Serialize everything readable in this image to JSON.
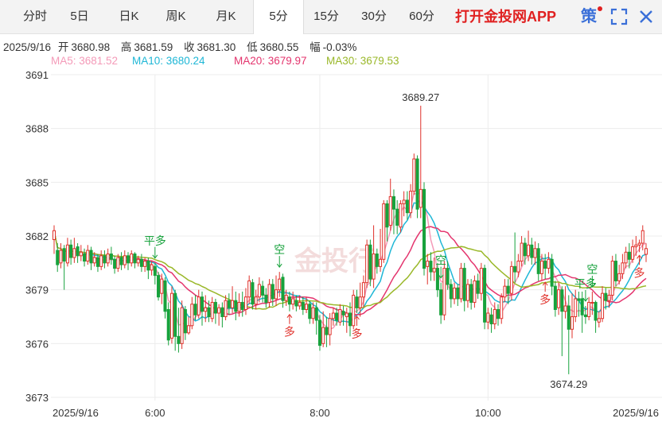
{
  "tabs": [
    {
      "label": "分时",
      "active": false
    },
    {
      "label": "5日",
      "active": false
    },
    {
      "label": "日K",
      "active": false
    },
    {
      "label": "周K",
      "active": false
    },
    {
      "label": "月K",
      "active": false
    },
    {
      "label": "5分",
      "active": true
    },
    {
      "label": "15分",
      "active": false
    },
    {
      "label": "30分",
      "active": false
    },
    {
      "label": "60分",
      "active": false
    }
  ],
  "brand": "打开金投网APP",
  "strategy_icon": "策",
  "colors": {
    "up": "#e0302a",
    "down": "#17a23c",
    "ma5": "#f49ab8",
    "ma10": "#1fb7d6",
    "ma20": "#e4356e",
    "ma30": "#9ab829"
  },
  "ohlc": {
    "date": "2025/9/16",
    "open_label": "开",
    "open": "3680.98",
    "high_label": "高",
    "high": "3681.59",
    "close_label": "收",
    "close": "3681.30",
    "low_label": "低",
    "low": "3680.55",
    "change_label": "幅",
    "change": "-0.03%"
  },
  "ma": {
    "ma5": "MA5: 3681.52",
    "ma10": "MA10: 3680.24",
    "ma20": "MA20: 3679.97",
    "ma30": "MA30: 3679.53"
  },
  "chart_data": {
    "type": "candlestick",
    "y_ticks": [
      "3691",
      "3688",
      "3685",
      "3682",
      "3679",
      "3676",
      "3673"
    ],
    "ylim": [
      3673,
      3691
    ],
    "x_ticks": [
      "2025/9/16",
      "6:00",
      "8:00",
      "10:00",
      "2025/9/16"
    ],
    "max_label": "3689.27",
    "min_label": "3674.29",
    "annotations": [
      {
        "text": "平多",
        "index": 30
      },
      {
        "text": "空",
        "index": 67
      },
      {
        "text": "多",
        "index": 70
      },
      {
        "text": "多",
        "index": 90
      },
      {
        "text": "空",
        "index": 115
      },
      {
        "text": "多",
        "index": 146
      },
      {
        "text": "平多",
        "index": 158
      },
      {
        "text": "空",
        "index": 160
      },
      {
        "text": "多",
        "index": 174
      }
    ],
    "candles": [
      [
        3681.8,
        3682.3,
        3681.0,
        3682.6
      ],
      [
        3681.2,
        3680.4,
        3680.0,
        3681.6
      ],
      [
        3680.5,
        3681.2,
        3680.2,
        3681.6
      ],
      [
        3681.3,
        3680.6,
        3679.0,
        3681.5
      ],
      [
        3680.5,
        3681.5,
        3680.3,
        3681.9
      ],
      [
        3681.5,
        3680.8,
        3680.4,
        3681.8
      ],
      [
        3680.8,
        3681.3,
        3680.5,
        3681.9
      ],
      [
        3681.4,
        3680.9,
        3680.5,
        3681.6
      ],
      [
        3680.9,
        3681.1,
        3680.6,
        3681.5
      ],
      [
        3681.0,
        3680.6,
        3680.3,
        3681.3
      ],
      [
        3680.6,
        3681.2,
        3680.4,
        3681.5
      ],
      [
        3681.2,
        3680.5,
        3680.1,
        3681.4
      ],
      [
        3680.5,
        3680.8,
        3680.3,
        3681.1
      ],
      [
        3680.8,
        3680.3,
        3680.0,
        3681.0
      ],
      [
        3680.3,
        3680.9,
        3680.1,
        3681.2
      ],
      [
        3680.9,
        3680.5,
        3680.2,
        3681.2
      ],
      [
        3680.5,
        3681.0,
        3680.3,
        3681.3
      ],
      [
        3681.0,
        3680.7,
        3680.4,
        3681.4
      ],
      [
        3680.7,
        3680.2,
        3679.9,
        3680.9
      ],
      [
        3680.2,
        3680.8,
        3680.0,
        3681.0
      ],
      [
        3680.8,
        3680.4,
        3680.1,
        3681.1
      ],
      [
        3680.4,
        3680.9,
        3680.2,
        3681.2
      ],
      [
        3680.9,
        3680.5,
        3680.1,
        3681.1
      ],
      [
        3680.5,
        3681.0,
        3680.3,
        3681.2
      ],
      [
        3681.0,
        3680.5,
        3680.2,
        3681.1
      ],
      [
        3680.5,
        3680.7,
        3680.3,
        3680.9
      ],
      [
        3680.7,
        3680.3,
        3680.0,
        3681.0
      ],
      [
        3680.3,
        3680.6,
        3680.0,
        3680.8
      ],
      [
        3680.6,
        3680.1,
        3679.6,
        3680.8
      ],
      [
        3680.1,
        3680.4,
        3679.8,
        3680.6
      ],
      [
        3680.3,
        3679.8,
        3679.3,
        3680.5
      ],
      [
        3679.8,
        3678.6,
        3678.4,
        3680.0
      ],
      [
        3678.8,
        3679.6,
        3678.2,
        3679.9
      ],
      [
        3679.5,
        3677.8,
        3677.4,
        3679.7
      ],
      [
        3677.9,
        3676.2,
        3675.9,
        3678.3
      ],
      [
        3676.3,
        3678.8,
        3676.0,
        3679.2
      ],
      [
        3678.8,
        3676.4,
        3675.6,
        3679.0
      ],
      [
        3676.4,
        3676.0,
        3675.5,
        3678.0
      ],
      [
        3676.0,
        3678.0,
        3675.7,
        3678.4
      ],
      [
        3677.9,
        3676.6,
        3676.2,
        3678.1
      ],
      [
        3676.6,
        3677.0,
        3676.5,
        3677.5
      ],
      [
        3677.0,
        3678.2,
        3676.8,
        3678.6
      ],
      [
        3678.2,
        3677.6,
        3677.3,
        3678.7
      ],
      [
        3677.6,
        3678.6,
        3677.4,
        3679.0
      ],
      [
        3678.6,
        3677.8,
        3677.0,
        3678.9
      ],
      [
        3677.8,
        3678.0,
        3677.2,
        3678.7
      ],
      [
        3678.0,
        3677.5,
        3677.2,
        3678.4
      ],
      [
        3677.4,
        3678.3,
        3677.2,
        3678.6
      ],
      [
        3678.3,
        3677.7,
        3677.1,
        3678.5
      ],
      [
        3677.7,
        3678.0,
        3677.0,
        3678.2
      ],
      [
        3678.0,
        3677.5,
        3676.9,
        3678.3
      ],
      [
        3677.5,
        3678.4,
        3677.3,
        3678.7
      ],
      [
        3678.4,
        3678.0,
        3677.6,
        3678.8
      ],
      [
        3678.0,
        3678.4,
        3677.7,
        3679.2
      ],
      [
        3678.4,
        3677.8,
        3677.3,
        3678.9
      ],
      [
        3677.8,
        3678.3,
        3677.5,
        3678.8
      ],
      [
        3678.3,
        3677.9,
        3677.5,
        3678.9
      ],
      [
        3677.9,
        3678.6,
        3677.6,
        3679.1
      ],
      [
        3678.6,
        3679.5,
        3678.2,
        3679.8
      ],
      [
        3679.4,
        3678.2,
        3677.9,
        3679.6
      ],
      [
        3678.2,
        3678.6,
        3677.9,
        3679.0
      ],
      [
        3678.6,
        3679.3,
        3678.3,
        3679.7
      ],
      [
        3679.2,
        3678.7,
        3678.3,
        3679.5
      ],
      [
        3678.7,
        3678.3,
        3678.0,
        3679.1
      ],
      [
        3678.3,
        3679.3,
        3678.0,
        3679.6
      ],
      [
        3679.3,
        3678.5,
        3678.1,
        3679.6
      ],
      [
        3678.5,
        3679.0,
        3678.1,
        3679.8
      ],
      [
        3679.0,
        3679.6,
        3678.6,
        3680.0
      ],
      [
        3679.7,
        3678.4,
        3678.0,
        3679.9
      ],
      [
        3678.4,
        3678.7,
        3678.1,
        3679.0
      ],
      [
        3678.6,
        3678.2,
        3677.8,
        3678.9
      ],
      [
        3678.2,
        3678.5,
        3677.9,
        3678.9
      ],
      [
        3678.4,
        3678.1,
        3677.8,
        3678.7
      ],
      [
        3678.1,
        3678.3,
        3677.9,
        3678.7
      ],
      [
        3678.3,
        3677.9,
        3677.6,
        3678.6
      ],
      [
        3677.9,
        3678.2,
        3677.7,
        3678.6
      ],
      [
        3678.2,
        3677.4,
        3677.1,
        3678.4
      ],
      [
        3677.4,
        3678.0,
        3677.1,
        3678.3
      ],
      [
        3678.0,
        3677.3,
        3676.5,
        3678.3
      ],
      [
        3677.3,
        3675.9,
        3675.6,
        3677.6
      ],
      [
        3676.0,
        3676.9,
        3675.8,
        3677.8
      ],
      [
        3676.9,
        3676.5,
        3675.8,
        3677.5
      ],
      [
        3676.5,
        3677.4,
        3675.9,
        3677.7
      ],
      [
        3677.4,
        3677.7,
        3677.0,
        3678.0
      ],
      [
        3677.7,
        3677.3,
        3677.0,
        3678.0
      ],
      [
        3677.2,
        3677.9,
        3677.0,
        3678.2
      ],
      [
        3677.8,
        3677.6,
        3677.0,
        3678.1
      ],
      [
        3677.5,
        3677.7,
        3676.6,
        3678.0
      ],
      [
        3677.7,
        3677.0,
        3676.4,
        3678.3
      ],
      [
        3677.0,
        3678.7,
        3676.8,
        3679.0
      ],
      [
        3678.6,
        3678.0,
        3677.7,
        3679.0
      ],
      [
        3678.0,
        3678.6,
        3677.5,
        3679.4
      ],
      [
        3678.6,
        3679.4,
        3678.0,
        3679.8
      ],
      [
        3679.4,
        3681.5,
        3679.1,
        3681.8
      ],
      [
        3681.5,
        3679.6,
        3679.2,
        3681.8
      ],
      [
        3679.6,
        3681.0,
        3679.1,
        3682.6
      ],
      [
        3681.0,
        3680.3,
        3679.9,
        3681.3
      ],
      [
        3680.3,
        3680.7,
        3680.0,
        3682.4
      ],
      [
        3680.7,
        3683.8,
        3680.5,
        3684.0
      ],
      [
        3683.8,
        3682.5,
        3681.7,
        3684.0
      ],
      [
        3682.6,
        3684.2,
        3682.3,
        3685.2
      ],
      [
        3684.2,
        3683.5,
        3682.1,
        3684.6
      ],
      [
        3683.5,
        3682.6,
        3682.1,
        3684.0
      ],
      [
        3682.5,
        3683.8,
        3682.2,
        3684.0
      ],
      [
        3683.8,
        3684.0,
        3683.1,
        3684.5
      ],
      [
        3684.0,
        3683.3,
        3682.9,
        3684.5
      ],
      [
        3683.3,
        3684.5,
        3683.0,
        3684.9
      ],
      [
        3684.5,
        3686.3,
        3684.3,
        3686.6
      ],
      [
        3686.3,
        3683.5,
        3683.0,
        3686.5
      ],
      [
        3683.6,
        3684.6,
        3683.0,
        3689.27
      ],
      [
        3684.6,
        3680.2,
        3679.8,
        3685.0
      ],
      [
        3680.3,
        3680.6,
        3679.3,
        3681.0
      ],
      [
        3680.6,
        3680.0,
        3679.5,
        3681.1
      ],
      [
        3680.0,
        3680.2,
        3679.5,
        3680.8
      ],
      [
        3680.2,
        3679.0,
        3678.6,
        3680.5
      ],
      [
        3679.0,
        3677.6,
        3677.1,
        3679.4
      ],
      [
        3677.6,
        3680.2,
        3677.3,
        3680.6
      ],
      [
        3680.2,
        3679.3,
        3679.0,
        3680.6
      ],
      [
        3679.3,
        3678.5,
        3678.0,
        3679.6
      ],
      [
        3678.5,
        3679.1,
        3678.2,
        3679.4
      ],
      [
        3679.1,
        3678.5,
        3678.1,
        3679.3
      ],
      [
        3678.5,
        3680.2,
        3678.3,
        3680.5
      ],
      [
        3680.2,
        3678.4,
        3677.8,
        3680.5
      ],
      [
        3678.4,
        3679.3,
        3678.0,
        3679.6
      ],
      [
        3679.3,
        3678.3,
        3677.9,
        3679.6
      ],
      [
        3678.3,
        3679.5,
        3678.0,
        3679.8
      ],
      [
        3679.5,
        3678.8,
        3678.5,
        3679.9
      ],
      [
        3678.8,
        3680.2,
        3678.4,
        3680.5
      ],
      [
        3680.2,
        3677.2,
        3676.8,
        3680.4
      ],
      [
        3677.2,
        3677.7,
        3676.8,
        3678.0
      ],
      [
        3677.6,
        3677.1,
        3676.6,
        3678.0
      ],
      [
        3677.1,
        3677.9,
        3676.8,
        3678.3
      ],
      [
        3677.9,
        3677.4,
        3677.0,
        3678.2
      ],
      [
        3677.4,
        3678.6,
        3677.1,
        3678.8
      ],
      [
        3678.6,
        3679.2,
        3678.3,
        3679.6
      ],
      [
        3679.2,
        3678.8,
        3678.2,
        3679.6
      ],
      [
        3678.8,
        3680.3,
        3678.4,
        3680.6
      ],
      [
        3680.3,
        3680.0,
        3679.4,
        3682.2
      ],
      [
        3680.0,
        3680.6,
        3679.7,
        3681.0
      ],
      [
        3680.6,
        3681.6,
        3680.3,
        3682.0
      ],
      [
        3681.6,
        3680.9,
        3680.4,
        3681.9
      ],
      [
        3680.9,
        3681.5,
        3680.6,
        3682.3
      ],
      [
        3681.5,
        3680.8,
        3680.4,
        3681.9
      ],
      [
        3680.8,
        3681.3,
        3680.4,
        3681.7
      ],
      [
        3681.3,
        3679.9,
        3679.5,
        3681.6
      ],
      [
        3679.9,
        3680.6,
        3679.5,
        3681.0
      ],
      [
        3680.6,
        3680.2,
        3679.6,
        3681.0
      ],
      [
        3680.2,
        3680.7,
        3679.9,
        3681.1
      ],
      [
        3680.7,
        3679.2,
        3678.7,
        3681.0
      ],
      [
        3679.2,
        3677.9,
        3677.5,
        3679.5
      ],
      [
        3678.0,
        3679.0,
        3677.6,
        3679.4
      ],
      [
        3679.0,
        3677.8,
        3675.3,
        3679.2
      ],
      [
        3677.8,
        3678.1,
        3677.4,
        3679.2
      ],
      [
        3678.1,
        3676.8,
        3674.29,
        3678.7
      ],
      [
        3676.8,
        3677.5,
        3676.3,
        3678.8
      ],
      [
        3677.5,
        3678.5,
        3677.2,
        3679.0
      ],
      [
        3678.5,
        3678.4,
        3677.5,
        3678.9
      ],
      [
        3678.5,
        3677.6,
        3676.6,
        3678.9
      ],
      [
        3677.6,
        3677.5,
        3677.1,
        3678.1
      ],
      [
        3677.5,
        3678.3,
        3677.3,
        3678.6
      ],
      [
        3678.3,
        3678.3,
        3677.6,
        3678.9
      ],
      [
        3678.3,
        3677.3,
        3676.6,
        3678.4
      ],
      [
        3677.2,
        3677.4,
        3676.9,
        3677.8
      ],
      [
        3677.4,
        3678.8,
        3677.2,
        3679.2
      ],
      [
        3678.8,
        3678.4,
        3677.9,
        3679.1
      ],
      [
        3678.4,
        3678.7,
        3678.0,
        3679.0
      ],
      [
        3678.7,
        3680.6,
        3678.4,
        3680.9
      ],
      [
        3680.6,
        3679.5,
        3679.2,
        3681.0
      ],
      [
        3679.5,
        3679.9,
        3679.3,
        3680.4
      ],
      [
        3679.9,
        3680.5,
        3679.6,
        3681.0
      ],
      [
        3680.5,
        3681.1,
        3680.2,
        3681.4
      ],
      [
        3681.1,
        3680.7,
        3680.2,
        3681.6
      ],
      [
        3680.7,
        3681.4,
        3680.5,
        3681.8
      ],
      [
        3681.4,
        3681.5,
        3680.9,
        3682.0
      ],
      [
        3681.5,
        3681.6,
        3681.1,
        3681.8
      ],
      [
        3681.6,
        3682.3,
        3681.2,
        3682.6
      ],
      [
        3680.98,
        3681.3,
        3680.55,
        3681.59
      ]
    ]
  }
}
